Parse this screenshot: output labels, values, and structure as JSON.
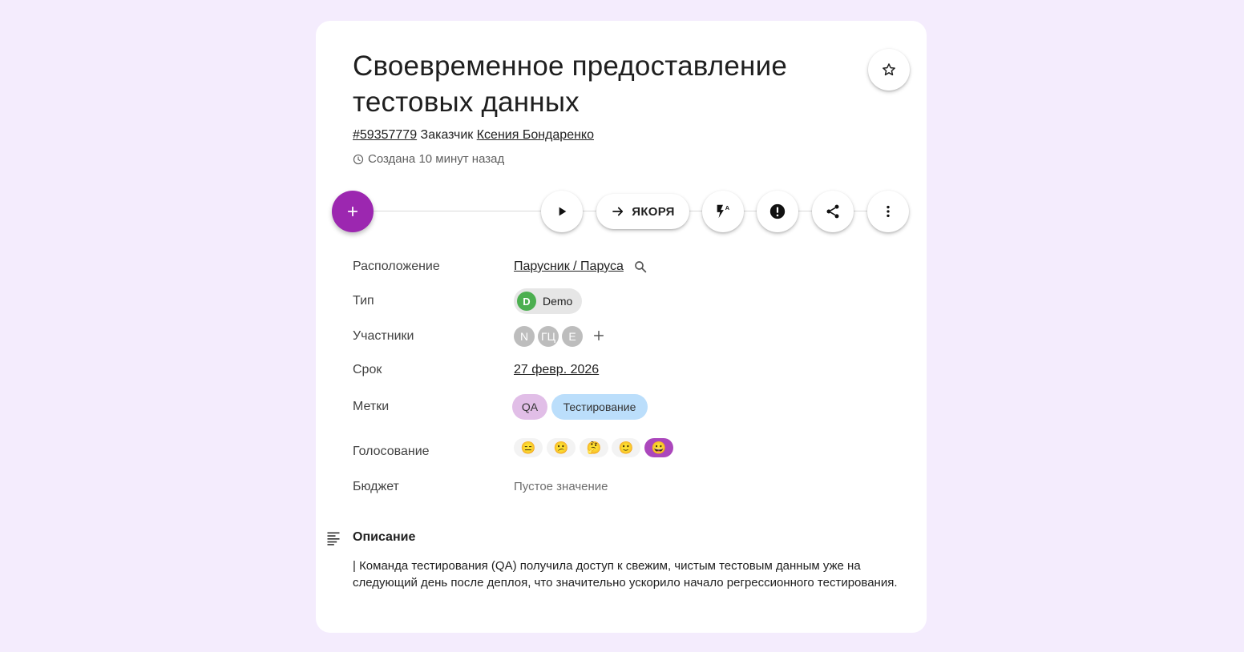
{
  "task": {
    "title": "Своевременное предоставление тестовых данных",
    "id": "#59357779",
    "customer_label": "Заказчик",
    "customer_name": "Ксения Бондаренко",
    "created": "Создана 10 минут назад"
  },
  "toolbar": {
    "add_label": "+",
    "anchors_label": "ЯКОРЯ"
  },
  "fields": {
    "location": {
      "label": "Расположение",
      "value": "Парусник / Паруса"
    },
    "type": {
      "label": "Тип",
      "avatar": "D",
      "value": "Demo",
      "avatar_color": "#4caf50"
    },
    "participants": {
      "label": "Участники",
      "avatars": [
        "N",
        "ГЦ",
        "E"
      ]
    },
    "deadline": {
      "label": "Срок",
      "value": "27 февр. 2026"
    },
    "tags": {
      "label": "Метки",
      "items": [
        {
          "text": "QA",
          "color": "#e1bee7"
        },
        {
          "text": "Тестирование",
          "color": "#bbdefb"
        }
      ]
    },
    "voting": {
      "label": "Голосование",
      "options": [
        "😑",
        "😕",
        "🤔",
        "🙂",
        "😀"
      ],
      "selected_index": 4
    },
    "budget": {
      "label": "Бюджет",
      "value": "Пустое значение"
    }
  },
  "description": {
    "title": "Описание",
    "text": "| Команда тестирования (QA) получила доступ к свежим, чистым тестовым данным уже на следующий день после деплоя, что значительно ускорило начало регрессионного тестирования."
  },
  "colors": {
    "accent": "#9c27b0",
    "background": "#f4ecfd",
    "vote_active": "#ab47bc"
  }
}
